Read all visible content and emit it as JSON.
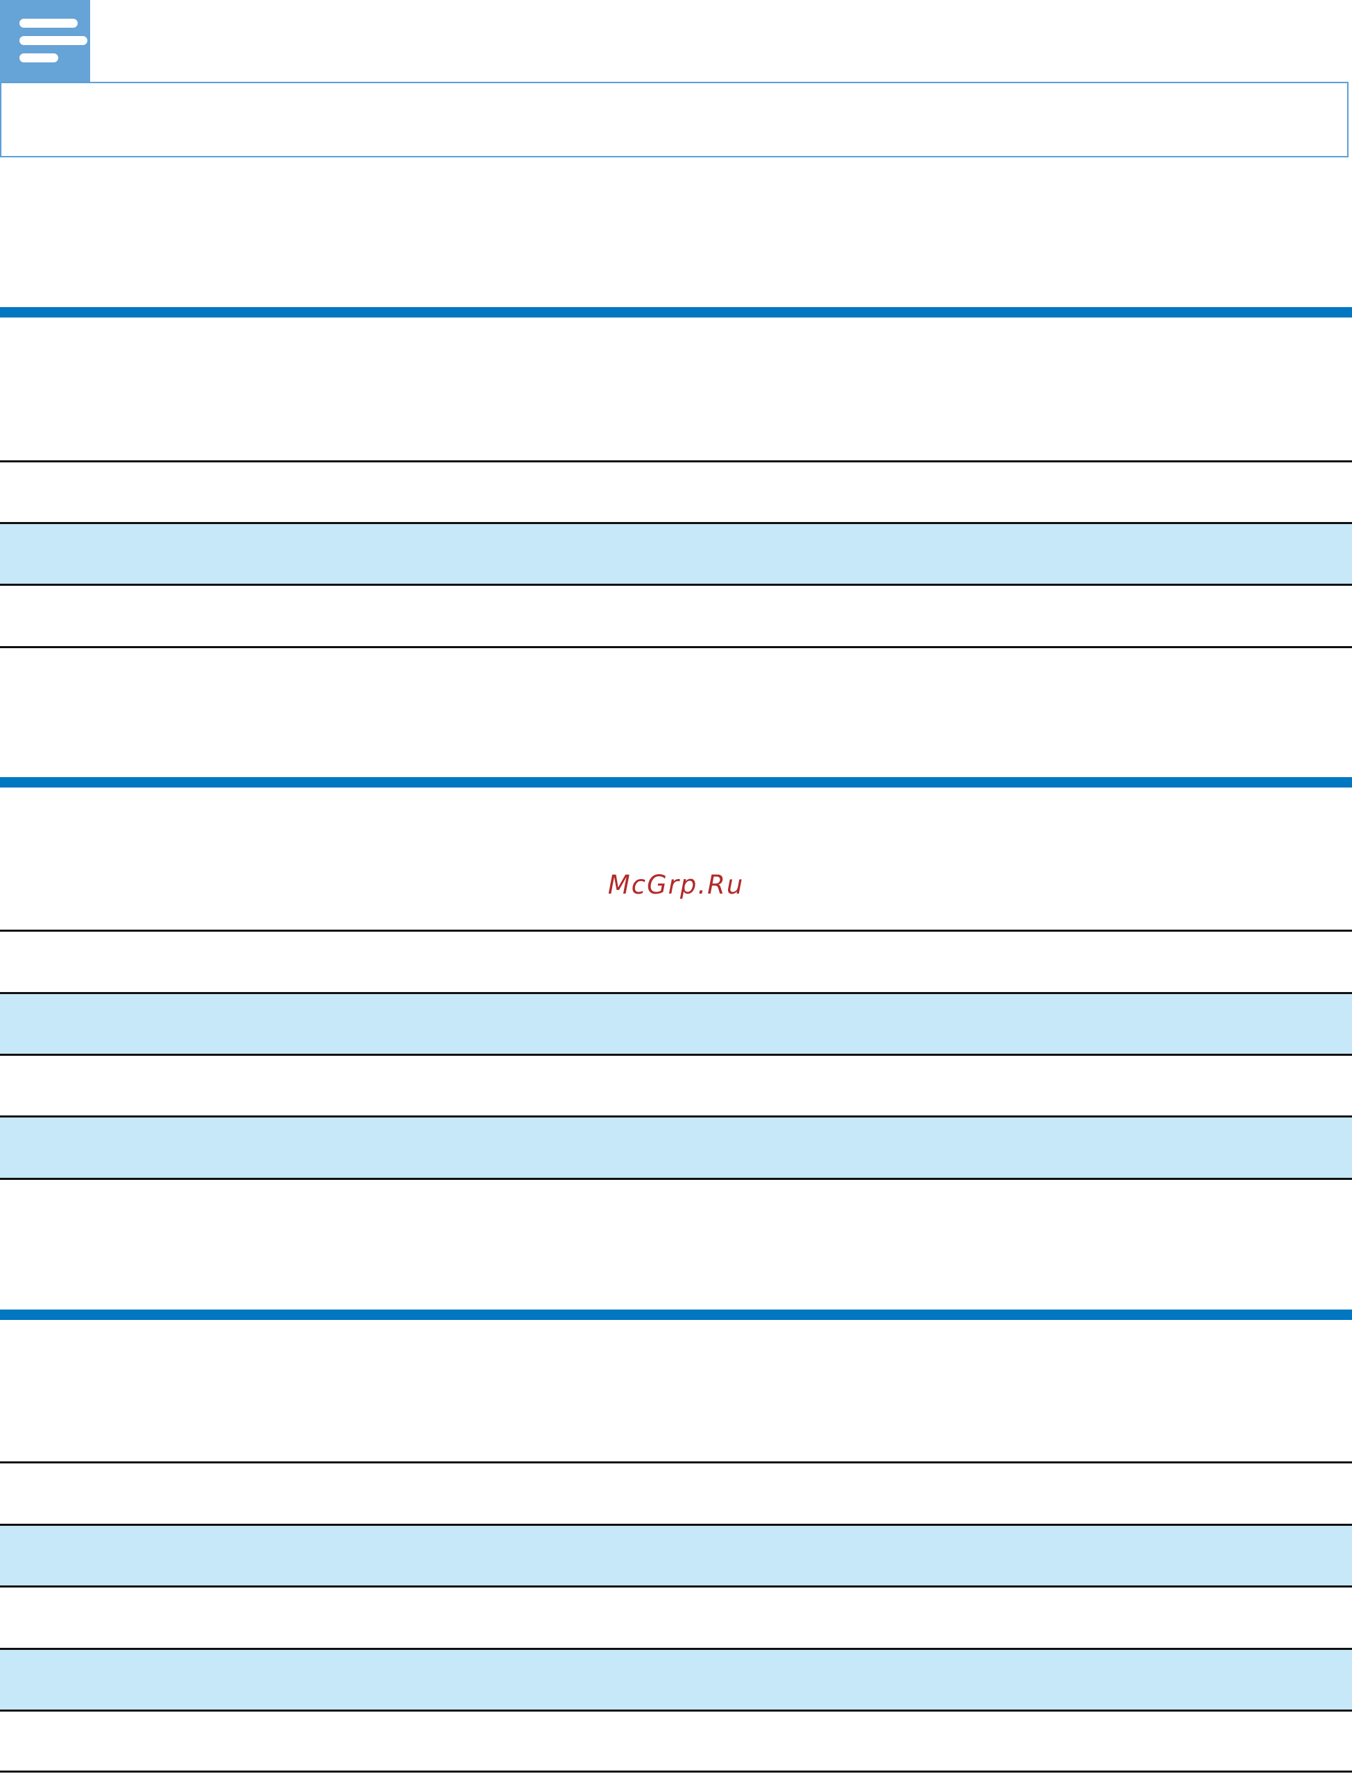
{
  "note": {
    "icon": "note-icon",
    "accent": "#66a3d6",
    "border": "#5aa0d8"
  },
  "colors": {
    "section_rule": "#0077c0",
    "row_line": "#111111",
    "row_shade": "#c6e8f8"
  },
  "watermark": {
    "text": "McGrp.Ru",
    "color": "#b32a2a"
  }
}
